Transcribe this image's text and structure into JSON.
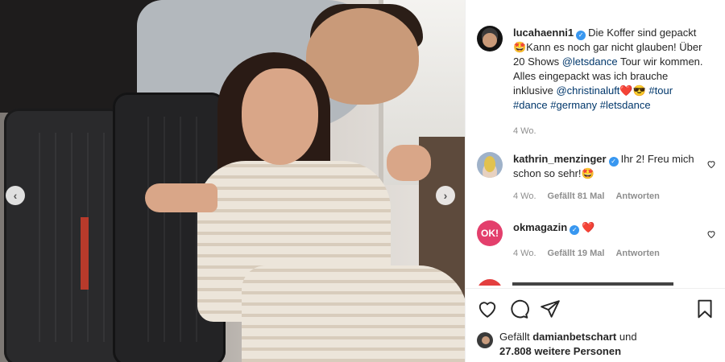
{
  "post": {
    "image_alt": "",
    "nav": {
      "prev_icon": "chevron-left-icon",
      "next_icon": "chevron-right-icon"
    }
  },
  "caption": {
    "username": "lucahaenni1",
    "verified": true,
    "text_before": "Die Koffer sind gepackt 🤩Kann es noch gar nicht glauben! Über 20 Shows ",
    "mention1": "@letsdance",
    "text_middle": " Tour wir kommen. Alles eingepackt was ich brauche inklusive ",
    "mention2": "@christinaluft",
    "emojis": "❤️😎",
    "tags": [
      "#tour",
      "#dance",
      "#germany",
      "#letsdance"
    ],
    "time": "4 Wo."
  },
  "comments": [
    {
      "username": "kathrin_menzinger",
      "verified": true,
      "text": "Ihr 2! Freu mich schon so sehr!🤩",
      "time": "4 Wo.",
      "likes": "Gefällt 81 Mal",
      "reply": "Antworten"
    },
    {
      "username": "okmagazin",
      "verified": true,
      "avatar_text": "OK!",
      "text": "❤️",
      "time": "4 Wo.",
      "likes": "Gefällt 19 Mal",
      "reply": "Antworten"
    }
  ],
  "actions": {
    "like_icon": "heart-icon",
    "comment_icon": "comment-icon",
    "share_icon": "share-icon",
    "save_icon": "bookmark-icon"
  },
  "likes": {
    "prefix": "Gefällt",
    "user": "damianbetschart",
    "middle": "und",
    "count": "27.808",
    "suffix": "weitere Personen"
  },
  "colors": {
    "verified": "#3897f0",
    "link": "#00376b",
    "meta": "#8e8e8e",
    "ok_brand": "#e33f6c"
  }
}
